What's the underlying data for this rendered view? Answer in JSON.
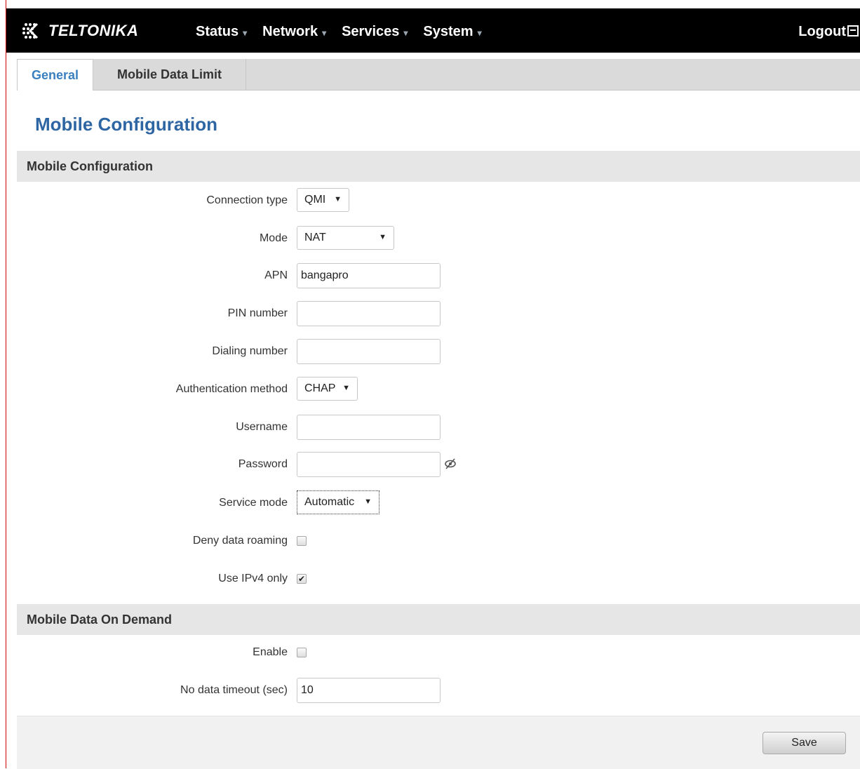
{
  "brand": {
    "logo_text": "TELTONIKA"
  },
  "nav": {
    "items": [
      {
        "label": "Status"
      },
      {
        "label": "Network"
      },
      {
        "label": "Services"
      },
      {
        "label": "System"
      }
    ],
    "logout_label": "Logout"
  },
  "tabs": [
    {
      "label": "General",
      "active": true
    },
    {
      "label": "Mobile Data Limit",
      "active": false
    }
  ],
  "page_title": "Mobile Configuration",
  "sections": {
    "mobile_configuration": {
      "title": "Mobile Configuration",
      "fields": {
        "connection_type": {
          "label": "Connection type",
          "value": "QMI"
        },
        "mode": {
          "label": "Mode",
          "value": "NAT"
        },
        "apn": {
          "label": "APN",
          "value": "bangapro"
        },
        "pin_number": {
          "label": "PIN number",
          "value": ""
        },
        "dialing_number": {
          "label": "Dialing number",
          "value": ""
        },
        "auth_method": {
          "label": "Authentication method",
          "value": "CHAP"
        },
        "username": {
          "label": "Username",
          "value": ""
        },
        "password": {
          "label": "Password",
          "value": ""
        },
        "service_mode": {
          "label": "Service mode",
          "value": "Automatic"
        },
        "deny_data_roaming": {
          "label": "Deny data roaming",
          "checked": false
        },
        "use_ipv4_only": {
          "label": "Use IPv4 only",
          "checked": true
        }
      }
    },
    "mobile_data_on_demand": {
      "title": "Mobile Data On Demand",
      "fields": {
        "enable": {
          "label": "Enable",
          "checked": false
        },
        "no_data_timeout": {
          "label": "No data timeout (sec)",
          "value": "10"
        }
      }
    }
  },
  "footer": {
    "save_label": "Save"
  },
  "colors": {
    "accent": "#2e66a3",
    "tab_active": "#3a7fc0",
    "topbar": "#000000"
  },
  "icons": {
    "logo": "teltonika-logo-icon",
    "password_toggle": "eye-slash-icon",
    "logout": "logout-icon"
  }
}
